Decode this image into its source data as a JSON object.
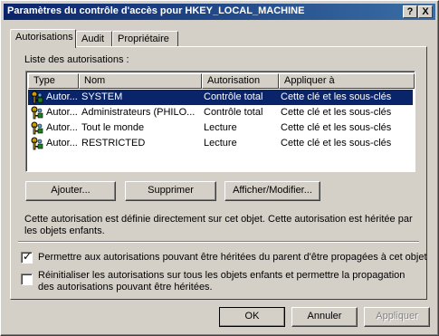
{
  "window": {
    "title": "Paramètres du contrôle d'accès pour HKEY_LOCAL_MACHINE",
    "help_label": "?",
    "close_label": "X"
  },
  "tabs": [
    {
      "label": "Autorisations",
      "active": true
    },
    {
      "label": "Audit",
      "active": false
    },
    {
      "label": "Propriétaire",
      "active": false
    }
  ],
  "permissions": {
    "list_label": "Liste des autorisations :",
    "columns": [
      "Type",
      "Nom",
      "Autorisation",
      "Appliquer à"
    ],
    "rows": [
      {
        "type": "Autor...",
        "name": "SYSTEM",
        "permission": "Contrôle total",
        "applies_to": "Cette clé et les sous-clés",
        "selected": true
      },
      {
        "type": "Autor...",
        "name": "Administrateurs (PHILO...",
        "permission": "Contrôle total",
        "applies_to": "Cette clé et les sous-clés",
        "selected": false
      },
      {
        "type": "Autor...",
        "name": "Tout le monde",
        "permission": "Lecture",
        "applies_to": "Cette clé et les sous-clés",
        "selected": false
      },
      {
        "type": "Autor...",
        "name": "RESTRICTED",
        "permission": "Lecture",
        "applies_to": "Cette clé et les sous-clés",
        "selected": false
      }
    ],
    "add_label": "Ajouter...",
    "remove_label": "Supprimer",
    "edit_label": "Afficher/Modifier...",
    "description": "Cette autorisation est définie directement sur cet objet. Cette autorisation est héritée par les objets enfants."
  },
  "options": {
    "inherit_label": "Permettre aux autorisations pouvant être héritées du parent d'être propagées à cet objet",
    "inherit_checked": true,
    "reset_label": "Réinitialiser les autorisations sur tous les objets enfants et permettre la propagation des autorisations pouvant être héritées.",
    "reset_checked": false
  },
  "footer": {
    "ok_label": "OK",
    "cancel_label": "Annuler",
    "apply_label": "Appliquer"
  },
  "icons": {
    "row_icon": "key-user-icon"
  }
}
